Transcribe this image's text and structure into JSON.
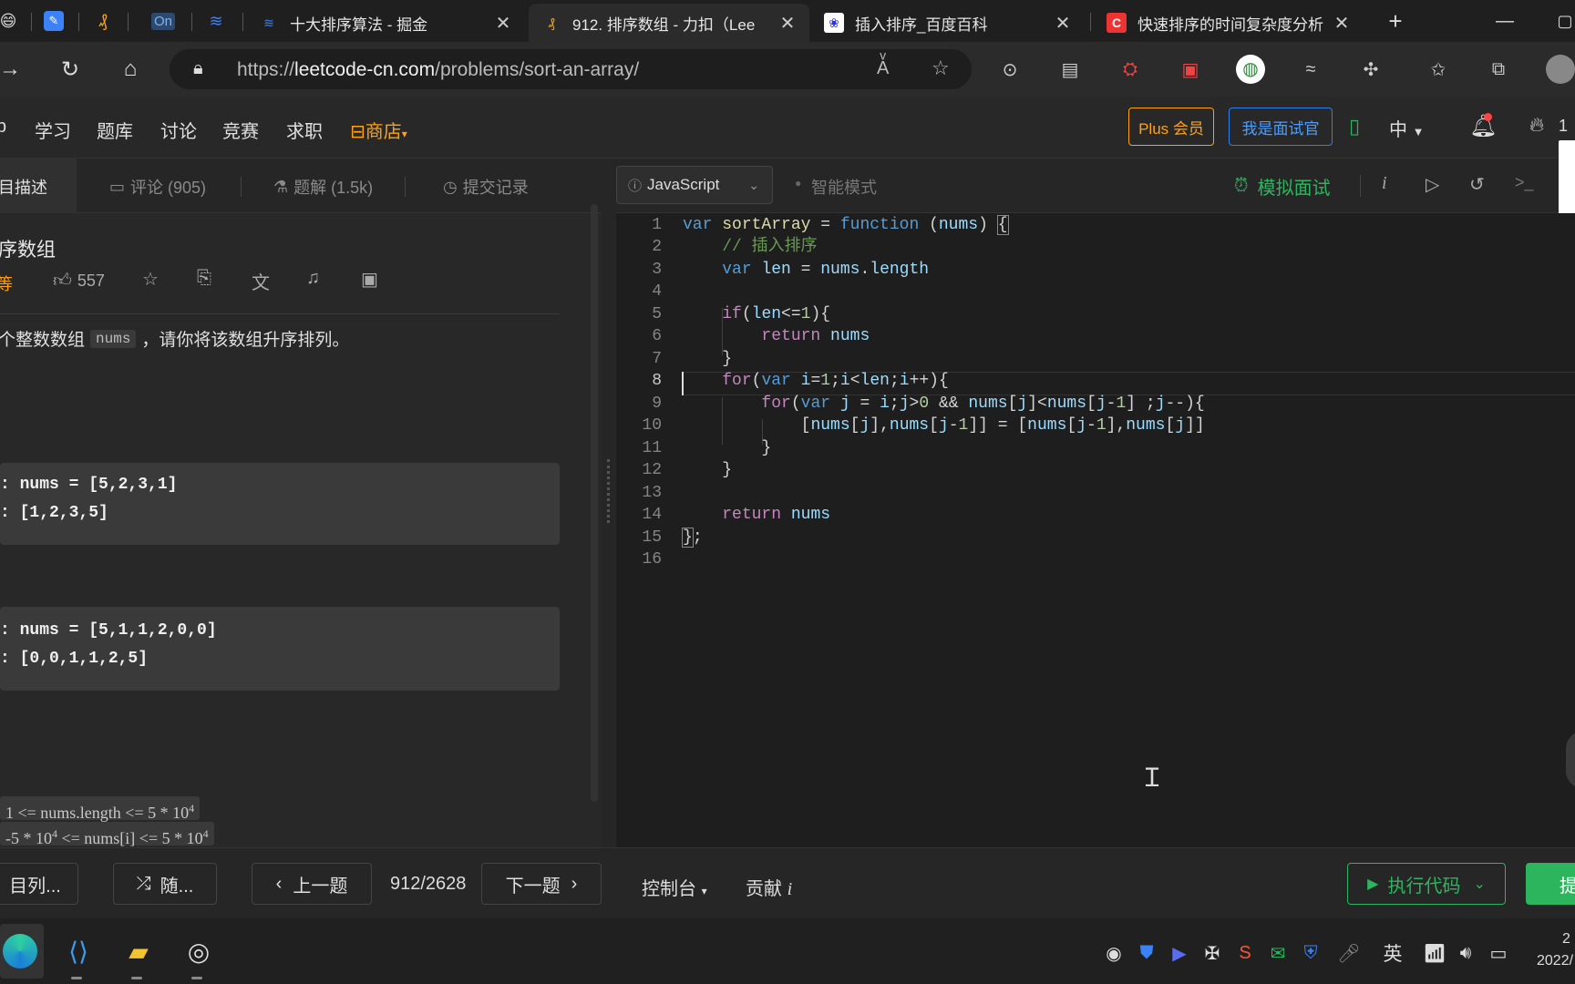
{
  "browser": {
    "tabs": [
      {
        "title": "十大排序算法 - 掘金"
      },
      {
        "title": "912. 排序数组 - 力扣（Lee"
      },
      {
        "title": "插入排序_百度百科"
      },
      {
        "title": "快速排序的时间复杂度分析"
      }
    ],
    "pinned_labels": [
      "On"
    ],
    "url_prefix": "https://",
    "url_domain": "leetcode-cn.com",
    "url_path": "/problems/sort-an-array/"
  },
  "site_nav": {
    "items": [
      "学习",
      "题库",
      "讨论",
      "竞赛",
      "求职"
    ],
    "store": "商店",
    "plus": "Plus 会员",
    "interviewer": "我是面试官",
    "lang": "中",
    "streak": "1"
  },
  "left": {
    "tabs": {
      "description": "目描述",
      "comments": "评论 (905)",
      "solutions": "题解 (1.5k)",
      "submissions": "提交记录"
    },
    "title": "序数组",
    "difficulty": "等",
    "likes": "557",
    "desc_before": "个整数数组",
    "desc_code": "nums",
    "desc_after": "，请你将该数组升序排列。",
    "example1": {
      "input": ": nums = [5,2,3,1]",
      "output": ": [1,2,3,5]"
    },
    "example2": {
      "input": ": nums = [5,1,1,2,0,0]",
      "output": ": [0,0,1,1,2,5]"
    },
    "constraint1": "1 <= nums.length <= 5 * 10",
    "constraint1_sup": "4",
    "constraint2": "-5 * 10",
    "constraint2_sup": "4",
    "constraint2_mid": " <= nums[i] <= 5 * 10",
    "constraint2_sup2": "4"
  },
  "editor": {
    "language": "JavaScript",
    "smart_mode": "智能模式",
    "mock_interview": "模拟面试",
    "info_label": "i"
  },
  "code_lines": [
    "1",
    "2",
    "3",
    "4",
    "5",
    "6",
    "7",
    "8",
    "9",
    "10",
    "11",
    "12",
    "13",
    "14",
    "15",
    "16"
  ],
  "bottom": {
    "problem_list": "目列...",
    "random": "随...",
    "prev": "上一题",
    "progress": "912/2628",
    "next": "下一题",
    "console": "控制台",
    "contribute": "贡献",
    "contribute_i": "i",
    "run": "执行代码",
    "submit": "提"
  },
  "taskbar": {
    "ime": "英",
    "time": "2",
    "date": "2022/"
  },
  "colors": {
    "accent_green": "#2db55d",
    "store_orange": "#ffa116",
    "plus_border": "#ffa116",
    "interviewer_blue": "#2f80ed"
  }
}
